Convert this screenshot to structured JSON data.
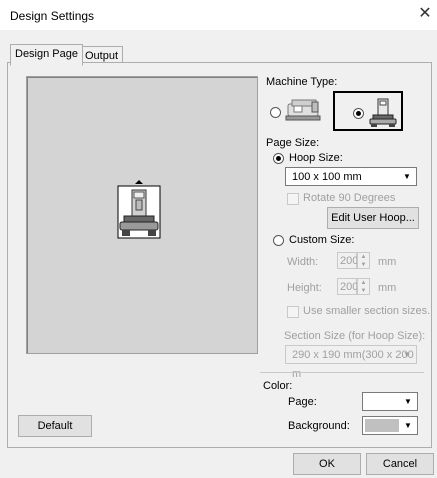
{
  "window": {
    "title": "Design Settings",
    "close_glyph": "✕"
  },
  "tabs": [
    {
      "label": "Design Page"
    },
    {
      "label": "Output"
    }
  ],
  "machine": {
    "label": "Machine Type:",
    "selected": "embroidery-machine"
  },
  "page_size": {
    "label": "Page Size:",
    "hoop_size_label": "Hoop Size:",
    "hoop_value": "100 x 100 mm",
    "rotate_label": "Rotate 90 Degrees",
    "edit_hoop_label": "Edit User Hoop...",
    "custom_size_label": "Custom Size:",
    "width_label": "Width:",
    "width_value": "200",
    "height_label": "Height:",
    "height_value": "200",
    "unit": "mm",
    "use_smaller_label": "Use smaller section sizes.",
    "section_size_label": "Section Size (for Hoop Size):",
    "section_value": "290 x 190 mm(300 x 200 m"
  },
  "color": {
    "label": "Color:",
    "page_label": "Page:",
    "background_label": "Background:",
    "page_color": "#ffffff",
    "background_color": "#c0c0c0"
  },
  "buttons": {
    "default": "Default",
    "ok": "OK",
    "cancel": "Cancel"
  }
}
